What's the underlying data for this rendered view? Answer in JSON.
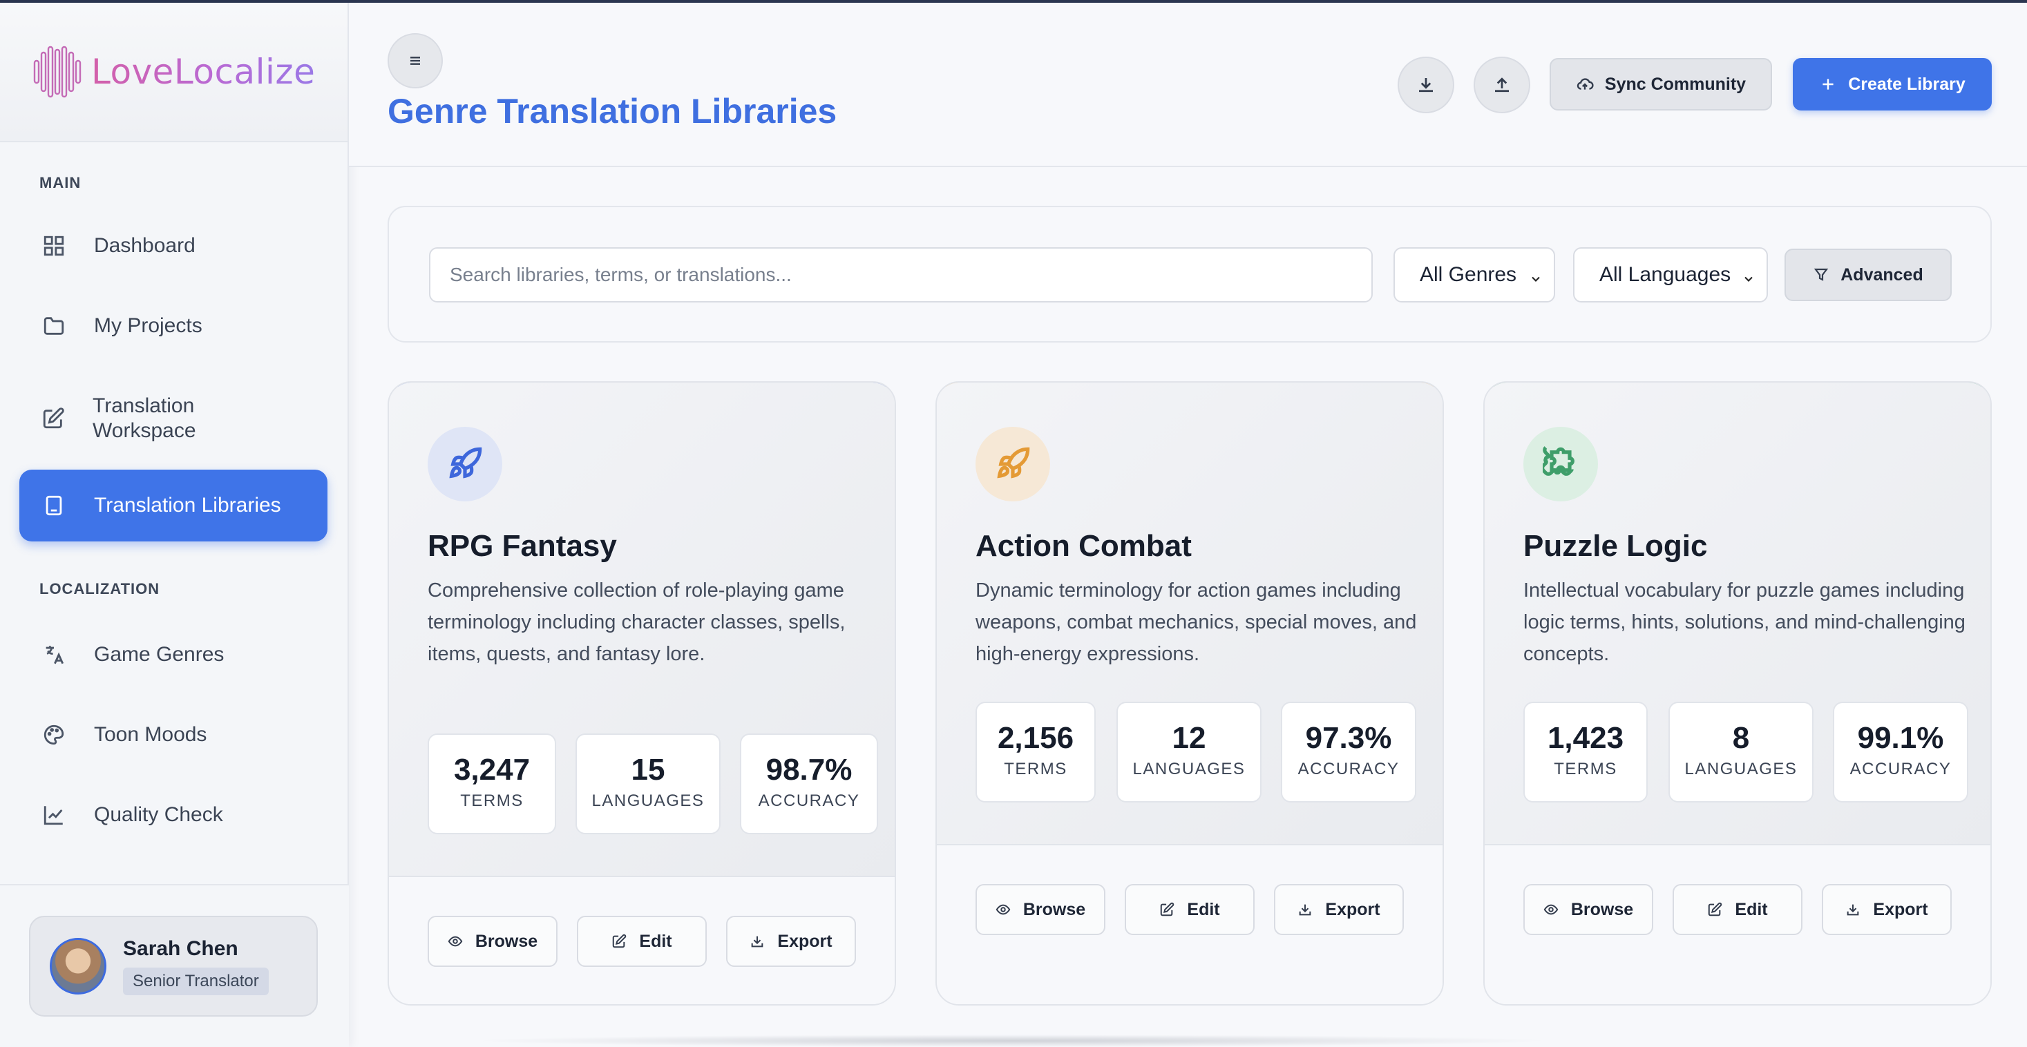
{
  "app": {
    "name": "LoveLocalize"
  },
  "sidebar": {
    "sections": [
      {
        "label": "MAIN"
      },
      {
        "label": "LOCALIZATION"
      }
    ],
    "items": [
      {
        "label": "Dashboard",
        "icon": "grid-icon"
      },
      {
        "label": "My Projects",
        "icon": "folder-icon"
      },
      {
        "label": "Translation Workspace",
        "icon": "edit-icon"
      },
      {
        "label": "Translation Libraries",
        "icon": "book-icon",
        "active": true
      },
      {
        "label": "Game Genres",
        "icon": "language-icon"
      },
      {
        "label": "Toon Moods",
        "icon": "palette-icon"
      },
      {
        "label": "Quality Check",
        "icon": "chart-line-icon"
      }
    ],
    "user": {
      "name": "Sarah Chen",
      "role": "Senior Translator"
    }
  },
  "header": {
    "title": "Genre Translation Libraries",
    "sync_label": "Sync Community",
    "create_label": "Create Library"
  },
  "filters": {
    "search_placeholder": "Search libraries, terms, or translations...",
    "genre_selected": "All Genres",
    "language_selected": "All Languages",
    "advanced_label": "Advanced"
  },
  "colors": {
    "primary": "#3f74e8",
    "rpg_accent": "#3e67db",
    "action_accent": "#eaa640",
    "puzzle_accent": "#4caf78"
  },
  "cards": [
    {
      "title": "RPG Fantasy",
      "description": "Comprehensive collection of role-playing game terminology including character classes, spells, items, quests, and fantasy lore.",
      "icon": "rocket-icon",
      "stats": [
        {
          "value": "3,247",
          "label": "TERMS"
        },
        {
          "value": "15",
          "label": "LANGUAGES"
        },
        {
          "value": "98.7%",
          "label": "ACCURACY"
        }
      ]
    },
    {
      "title": "Action Combat",
      "description": "Dynamic terminology for action games including weapons, combat mechanics, special moves, and high-energy expressions.",
      "icon": "rocket-icon",
      "stats": [
        {
          "value": "2,156",
          "label": "TERMS"
        },
        {
          "value": "12",
          "label": "LANGUAGES"
        },
        {
          "value": "97.3%",
          "label": "ACCURACY"
        }
      ]
    },
    {
      "title": "Puzzle Logic",
      "description": "Intellectual vocabulary for puzzle games including logic terms, hints, solutions, and mind-challenging concepts.",
      "icon": "puzzle-icon",
      "stats": [
        {
          "value": "1,423",
          "label": "TERMS"
        },
        {
          "value": "8",
          "label": "LANGUAGES"
        },
        {
          "value": "99.1%",
          "label": "ACCURACY"
        }
      ]
    }
  ],
  "card_actions": {
    "browse": "Browse",
    "edit": "Edit",
    "export": "Export"
  }
}
